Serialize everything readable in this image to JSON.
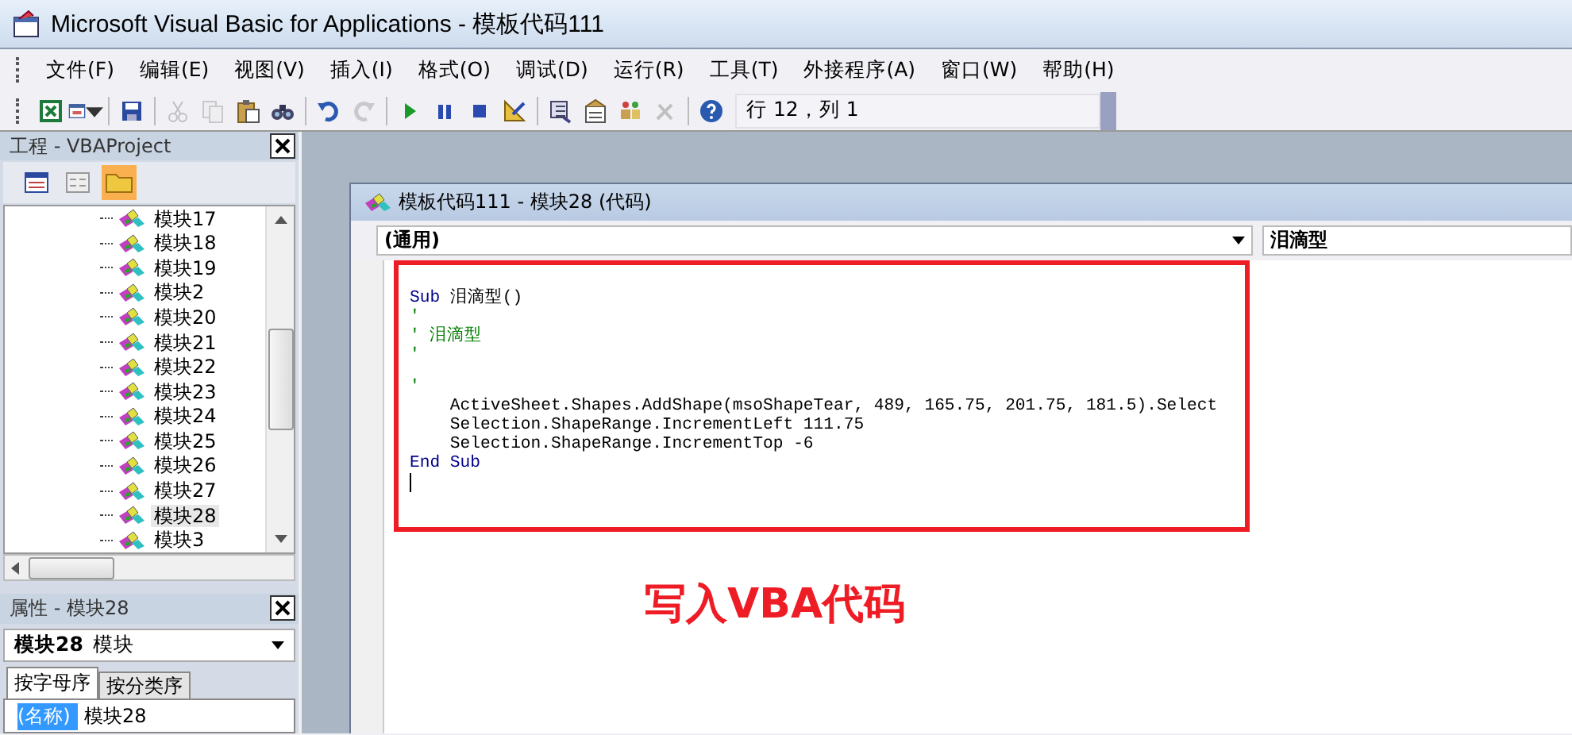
{
  "window": {
    "title": "Microsoft Visual Basic for Applications - 模板代码111"
  },
  "menu": [
    "文件(F)",
    "编辑(E)",
    "视图(V)",
    "插入(I)",
    "格式(O)",
    "调试(D)",
    "运行(R)",
    "工具(T)",
    "外接程序(A)",
    "窗口(W)",
    "帮助(H)"
  ],
  "toolbar": {
    "buttons": [
      {
        "kind": "excel",
        "disabled": false
      },
      {
        "kind": "userform",
        "disabled": false
      },
      {
        "kind": "sep"
      },
      {
        "kind": "save",
        "disabled": false
      },
      {
        "kind": "sep"
      },
      {
        "kind": "cut",
        "disabled": true
      },
      {
        "kind": "copy",
        "disabled": true
      },
      {
        "kind": "paste",
        "disabled": false
      },
      {
        "kind": "find",
        "disabled": false
      },
      {
        "kind": "sep"
      },
      {
        "kind": "undo",
        "disabled": false
      },
      {
        "kind": "redo",
        "disabled": true
      },
      {
        "kind": "sep"
      },
      {
        "kind": "run",
        "disabled": false
      },
      {
        "kind": "pause",
        "disabled": false
      },
      {
        "kind": "stop",
        "disabled": false
      },
      {
        "kind": "design",
        "disabled": false
      },
      {
        "kind": "sep"
      },
      {
        "kind": "explorer",
        "disabled": false
      },
      {
        "kind": "properties",
        "disabled": false
      },
      {
        "kind": "browser",
        "disabled": false
      },
      {
        "kind": "toolbox",
        "disabled": true
      },
      {
        "kind": "sep"
      },
      {
        "kind": "help",
        "disabled": false
      }
    ],
    "position": "行 12，列 1"
  },
  "project": {
    "title": "工程 - VBAProject",
    "view_buttons": [
      {
        "kind": "code",
        "selected": false
      },
      {
        "kind": "object",
        "selected": false
      },
      {
        "kind": "folders",
        "selected": true
      }
    ],
    "items": [
      {
        "label": "模块17",
        "selected": false
      },
      {
        "label": "模块18",
        "selected": false
      },
      {
        "label": "模块19",
        "selected": false
      },
      {
        "label": "模块2",
        "selected": false
      },
      {
        "label": "模块20",
        "selected": false
      },
      {
        "label": "模块21",
        "selected": false
      },
      {
        "label": "模块22",
        "selected": false
      },
      {
        "label": "模块23",
        "selected": false
      },
      {
        "label": "模块24",
        "selected": false
      },
      {
        "label": "模块25",
        "selected": false
      },
      {
        "label": "模块26",
        "selected": false
      },
      {
        "label": "模块27",
        "selected": false
      },
      {
        "label": "模块28",
        "selected": true
      },
      {
        "label": "模块3",
        "selected": false
      }
    ]
  },
  "properties": {
    "title": "属性 - 模块28",
    "object_name": "模块28",
    "object_type": "模块",
    "tabs": [
      {
        "label": "按字母序",
        "selected": true
      },
      {
        "label": "按分类序",
        "selected": false
      }
    ],
    "rows": [
      {
        "name": "(名称)",
        "value": "模块28",
        "selected": true
      }
    ]
  },
  "code_window": {
    "title": "模板代码111 - 模块28 (代码)",
    "object": "(通用)",
    "procedure": "泪滴型",
    "lines": [
      {
        "kind": "code",
        "segments": [
          {
            "kind": "keyword",
            "text": "Sub"
          },
          {
            "kind": "plain",
            "text": " 泪滴型()"
          }
        ]
      },
      {
        "kind": "code",
        "segments": [
          {
            "kind": "comment",
            "text": "'"
          }
        ]
      },
      {
        "kind": "code",
        "segments": [
          {
            "kind": "comment",
            "text": "' 泪滴型"
          }
        ]
      },
      {
        "kind": "code",
        "segments": [
          {
            "kind": "comment",
            "text": "'"
          }
        ]
      },
      {
        "kind": "blank"
      },
      {
        "kind": "code",
        "segments": [
          {
            "kind": "comment",
            "text": "'"
          }
        ]
      },
      {
        "kind": "code",
        "segments": [
          {
            "kind": "plain",
            "text": "    ActiveSheet.Shapes.AddShape(msoShapeTear, 489, 165.75, 201.75, 181.5).Select"
          }
        ]
      },
      {
        "kind": "code",
        "segments": [
          {
            "kind": "plain",
            "text": "    Selection.ShapeRange.IncrementLeft 111.75"
          }
        ]
      },
      {
        "kind": "code",
        "segments": [
          {
            "kind": "plain",
            "text": "    Selection.ShapeRange.IncrementTop -6"
          }
        ]
      },
      {
        "kind": "code",
        "segments": [
          {
            "kind": "keyword",
            "text": "End Sub"
          }
        ]
      },
      {
        "kind": "cursor"
      }
    ]
  },
  "annotation": "写入VBA代码"
}
